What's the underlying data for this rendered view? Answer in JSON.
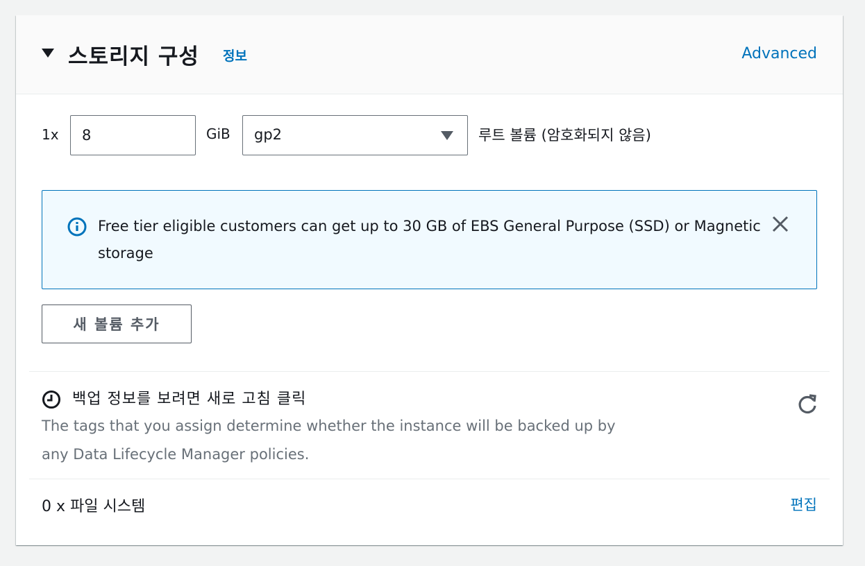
{
  "header": {
    "title": "스토리지 구성",
    "info_link": "정보",
    "advanced_link": "Advanced"
  },
  "volume": {
    "count_label": "1x",
    "size_value": "8",
    "unit": "GiB",
    "type_value": "gp2",
    "description": "루트 볼륨  (암호화되지 않음)"
  },
  "alert": {
    "message": "Free tier eligible customers can get up to 30 GB of EBS General Purpose (SSD) or Magnetic storage",
    "icon": "info-icon",
    "close_icon": "close-icon"
  },
  "add_volume_button": "새 볼륨 추가",
  "backup": {
    "title": "백업 정보를 보려면 새로 고침 클릭",
    "description": "The tags that you assign determine whether the instance will be backed up by any Data Lifecycle Manager policies.",
    "icon": "clock-icon",
    "refresh_icon": "refresh-icon"
  },
  "file_systems": {
    "label": "0 x 파일 시스템",
    "edit_link": "편집"
  },
  "colors": {
    "link": "#0073bb",
    "alert_background": "#f1faff",
    "alert_border": "#0073bb",
    "text": "#16191f",
    "secondary_text": "#687078"
  }
}
